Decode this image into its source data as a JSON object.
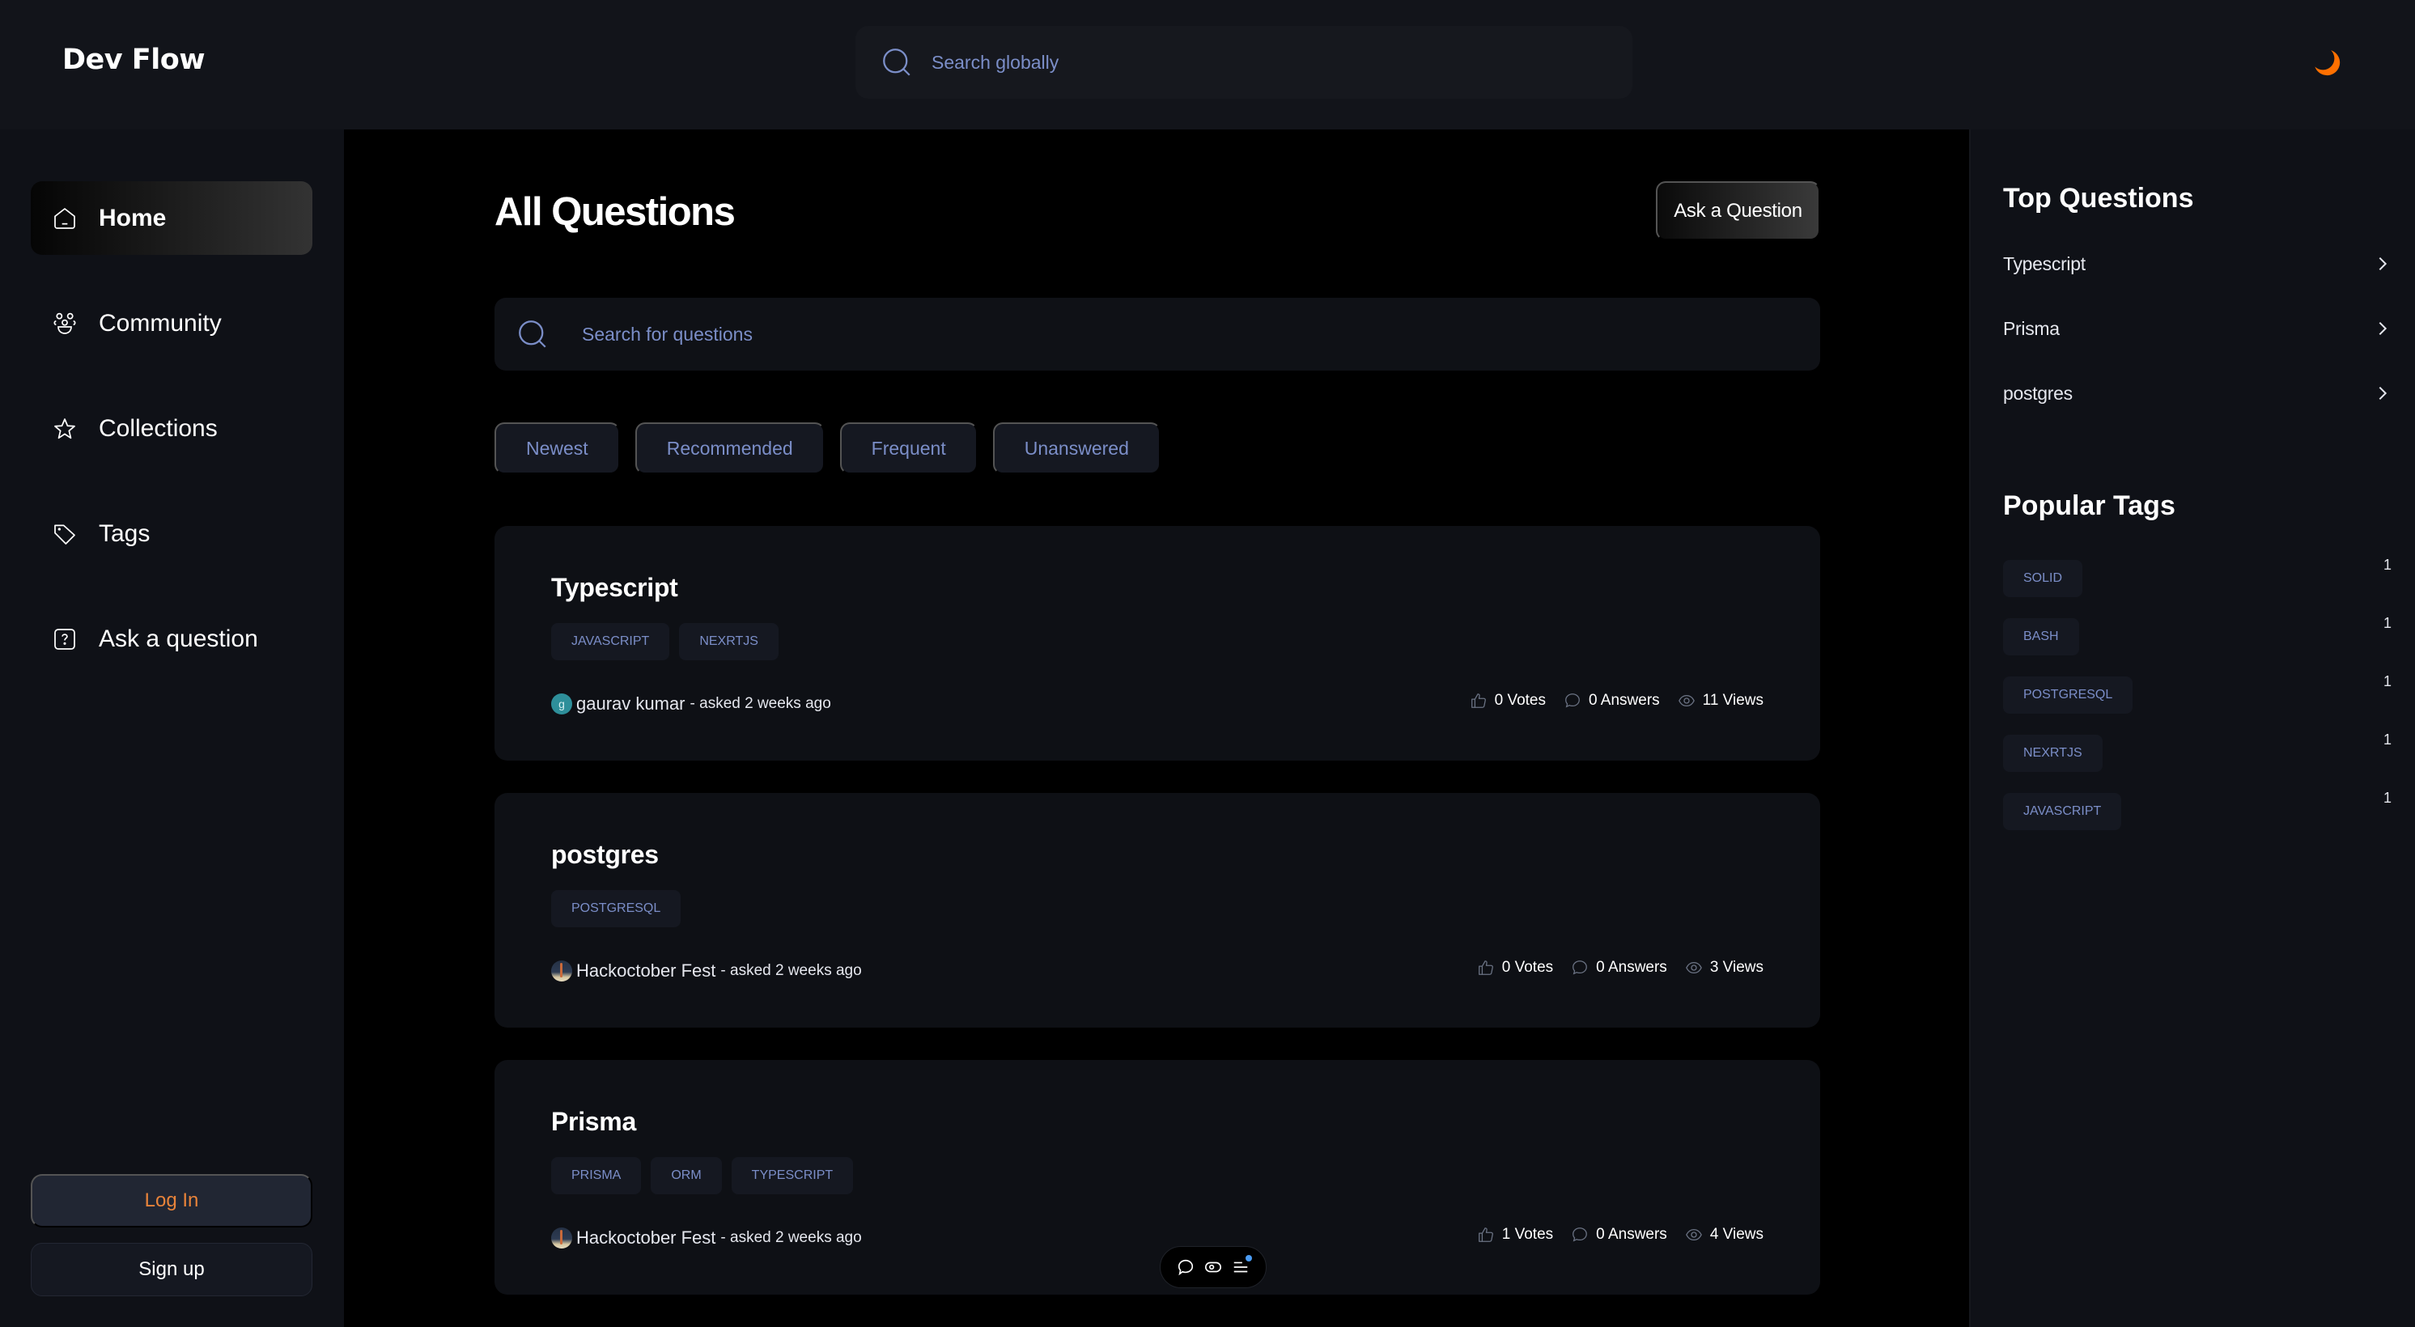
{
  "header": {
    "logo": "Dev Flow",
    "search_placeholder": "Search globally",
    "theme_icon": "moon-icon",
    "accent_color": "#ff7000"
  },
  "sidebar": {
    "items": [
      {
        "label": "Home",
        "icon": "home-icon",
        "active": true
      },
      {
        "label": "Community",
        "icon": "users-icon",
        "active": false
      },
      {
        "label": "Collections",
        "icon": "star-icon",
        "active": false
      },
      {
        "label": "Tags",
        "icon": "tag-icon",
        "active": false
      },
      {
        "label": "Ask a question",
        "icon": "question-icon",
        "active": false
      }
    ],
    "login_label": "Log In",
    "signup_label": "Sign up"
  },
  "main": {
    "title": "All Questions",
    "ask_button": "Ask a Question",
    "search_placeholder": "Search for questions",
    "filters": [
      "Newest",
      "Recommended",
      "Frequent",
      "Unanswered"
    ],
    "questions": [
      {
        "title": "Typescript",
        "tags": [
          "JAVASCRIPT",
          "NEXRTJS"
        ],
        "author": "gaurav kumar",
        "avatar_initial": "g",
        "asked": "- asked 2 weeks ago",
        "votes": "0 Votes",
        "answers": "0 Answers",
        "views": "11 Views"
      },
      {
        "title": "postgres",
        "tags": [
          "POSTGRESQL"
        ],
        "author": "Hackoctober Fest",
        "avatar_initial": "",
        "asked": "- asked 2 weeks ago",
        "votes": "0 Votes",
        "answers": "0 Answers",
        "views": "3 Views"
      },
      {
        "title": "Prisma",
        "tags": [
          "PRISMA",
          "ORM",
          "TYPESCRIPT"
        ],
        "author": "Hackoctober Fest",
        "avatar_initial": "",
        "asked": "- asked 2 weeks ago",
        "votes": "1 Votes",
        "answers": "0 Answers",
        "views": "4 Views"
      }
    ]
  },
  "floating_toolbar": {
    "icons": [
      "comment-icon",
      "eye-toggle-icon",
      "menu-notification-icon"
    ]
  },
  "right_sidebar": {
    "top_questions_heading": "Top Questions",
    "top_questions": [
      "Typescript",
      "Prisma",
      "postgres"
    ],
    "popular_tags_heading": "Popular Tags",
    "popular_tags": [
      {
        "name": "SOLID",
        "count": "1"
      },
      {
        "name": "BASH",
        "count": "1"
      },
      {
        "name": "POSTGRESQL",
        "count": "1"
      },
      {
        "name": "NEXRTJS",
        "count": "1"
      },
      {
        "name": "JAVASCRIPT",
        "count": "1"
      }
    ]
  }
}
